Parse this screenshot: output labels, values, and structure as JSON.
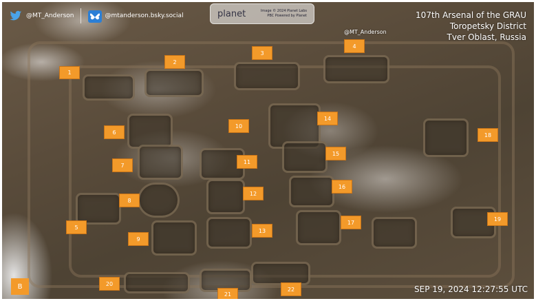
{
  "social": {
    "twitter_handle": "@MT_Anderson",
    "bluesky_handle": "@mtanderson.bsky.social"
  },
  "planet": {
    "logo": "planet",
    "credit_line1": "Image © 2024 Planet Labs",
    "credit_line2": "PBC Powered by Planet"
  },
  "title": {
    "line1": "107th Arsenal of the GRAU",
    "line2": "Toropetsky District",
    "line3": "Tver Oblast, Russia"
  },
  "overlay_handle": "@MT_Anderson",
  "panel_letter": "B",
  "timestamp": "SEP 19, 2024 12:27:55 UTC",
  "markers": [
    "1",
    "2",
    "3",
    "4",
    "5",
    "6",
    "7",
    "8",
    "9",
    "10",
    "11",
    "12",
    "13",
    "14",
    "15",
    "16",
    "17",
    "18",
    "19",
    "20",
    "21",
    "22"
  ],
  "colors": {
    "marker": "#f39a2a",
    "text": "#ffffff"
  }
}
